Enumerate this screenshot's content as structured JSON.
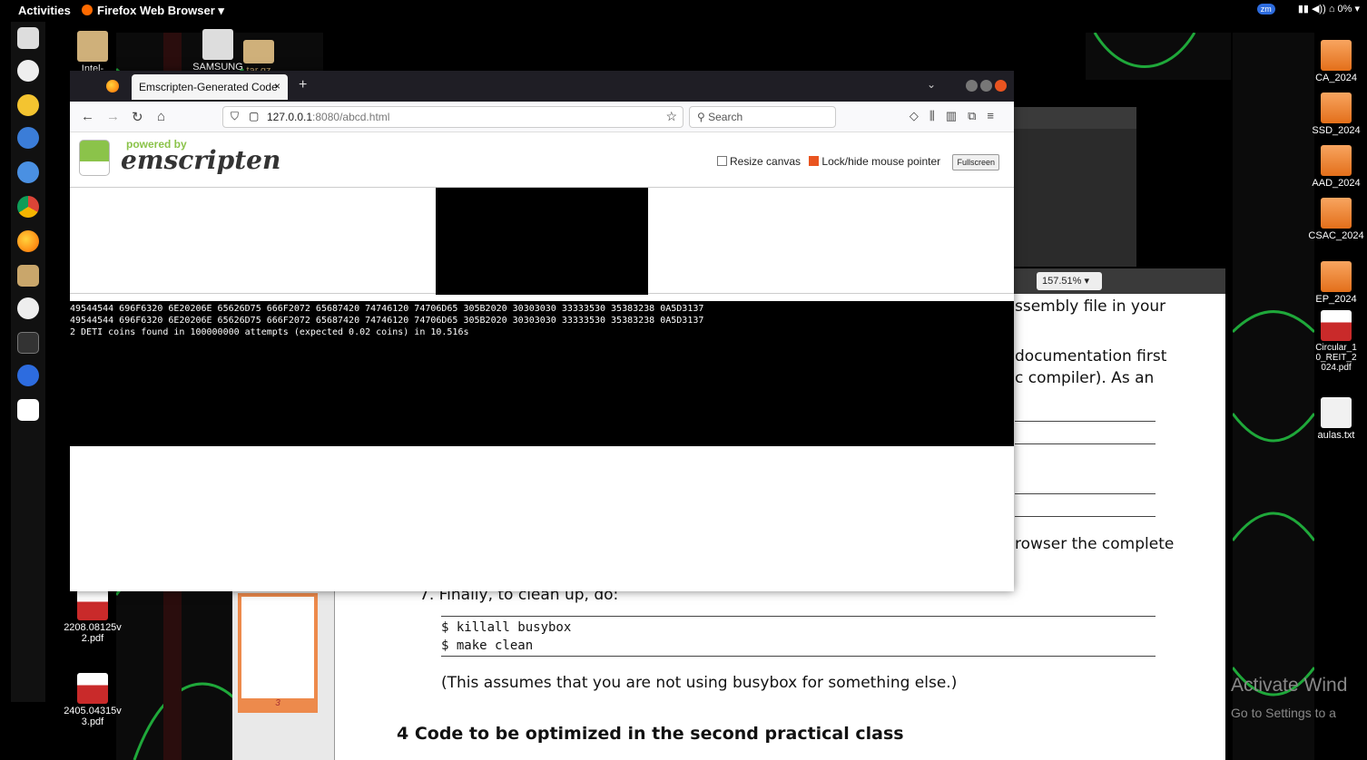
{
  "topbar": {
    "activities": "Activities",
    "app_menu": "Firefox Web Browser ▾",
    "zoom_badge": "zm",
    "tray": "▮▮ ◀)) ⌂ 0% ▾"
  },
  "desktop": {
    "icons_top": [
      {
        "label": "Intel-"
      },
      {
        "label": "SAMSUNG"
      },
      {
        "label": "tar.gz"
      }
    ],
    "icons_right": [
      {
        "label": "CA_2024"
      },
      {
        "label": "SSD_2024"
      },
      {
        "label": "AAD_2024"
      },
      {
        "label": "CSAC_2024"
      },
      {
        "label": "EP_2024"
      },
      {
        "label": "Circular_10_REIT_2024.pdf"
      },
      {
        "label": "aulas.txt"
      }
    ],
    "icons_left": [
      {
        "label": "2208.08125v2.pdf"
      },
      {
        "label": "2405.04315v3.pdf"
      }
    ]
  },
  "browser": {
    "tab_title": "Emscripten-Generated Code",
    "url_host": "127.0.0.1",
    "url_rest": ":8080/abcd.html",
    "search_placeholder": "Search",
    "powered_by": "powered by",
    "emscripten": "emscripten",
    "resize_canvas": "Resize canvas",
    "lock_pointer": "Lock/hide mouse pointer",
    "fullscreen": "Fullscreen",
    "output_lines": [
      "49544544 696F6320 6E20206E 65626D75 666F2072 65687420 74746120 74706D65 305B2020 30303030 33333530 35383238 0A5D3137",
      "49544544 696F6320 6E20206E 65626D75 666F2072 65687420 74746120 74706D65 305B2020 30303030 33333530 35383238 0A5D3137",
      "2 DETI coins found in 100000000 attempts (expected 0.02 coins) in 10.516s"
    ]
  },
  "pdf": {
    "zoom": "157.51% ▾",
    "line1": "ssembly file in your",
    "line2": "documentation first",
    "line3": "c compiler).  As an",
    "line4": "rowser the complete",
    "step7": "7.  Finally, to clean up, do:",
    "code1": "$ killall busybox",
    "code2": "$ make clean",
    "note": "(This assumes that you are not using busybox for something else.)",
    "section": "4    Code to be optimized in the second practical class",
    "page_num": "3"
  },
  "watermark": {
    "line1": "Activate Wind",
    "line2": "Go to Settings to a"
  }
}
